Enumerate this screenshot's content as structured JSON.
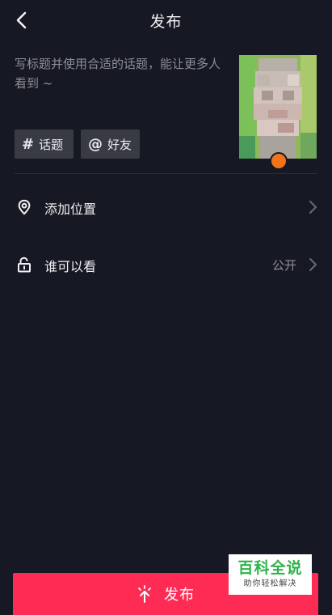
{
  "header": {
    "title": "发布"
  },
  "composer": {
    "caption_placeholder": "写标题并使用合适的话题，能让更多人看到 ~",
    "tags": [
      {
        "symbol": "#",
        "label": "话题"
      },
      {
        "symbol": "@",
        "label": "好友"
      }
    ]
  },
  "options": {
    "location": {
      "label": "添加位置",
      "icon": "location-pin-icon"
    },
    "privacy": {
      "label": "谁可以看",
      "value": "公开",
      "icon": "unlock-icon"
    }
  },
  "footer": {
    "publish_label": "发布"
  },
  "watermark": {
    "title": "百科全说",
    "subtitle": "助你轻松解决"
  },
  "colors": {
    "background": "#161823",
    "accent": "#fe2c55",
    "tag_background": "#393b44",
    "muted_text": "#8d8e96"
  }
}
